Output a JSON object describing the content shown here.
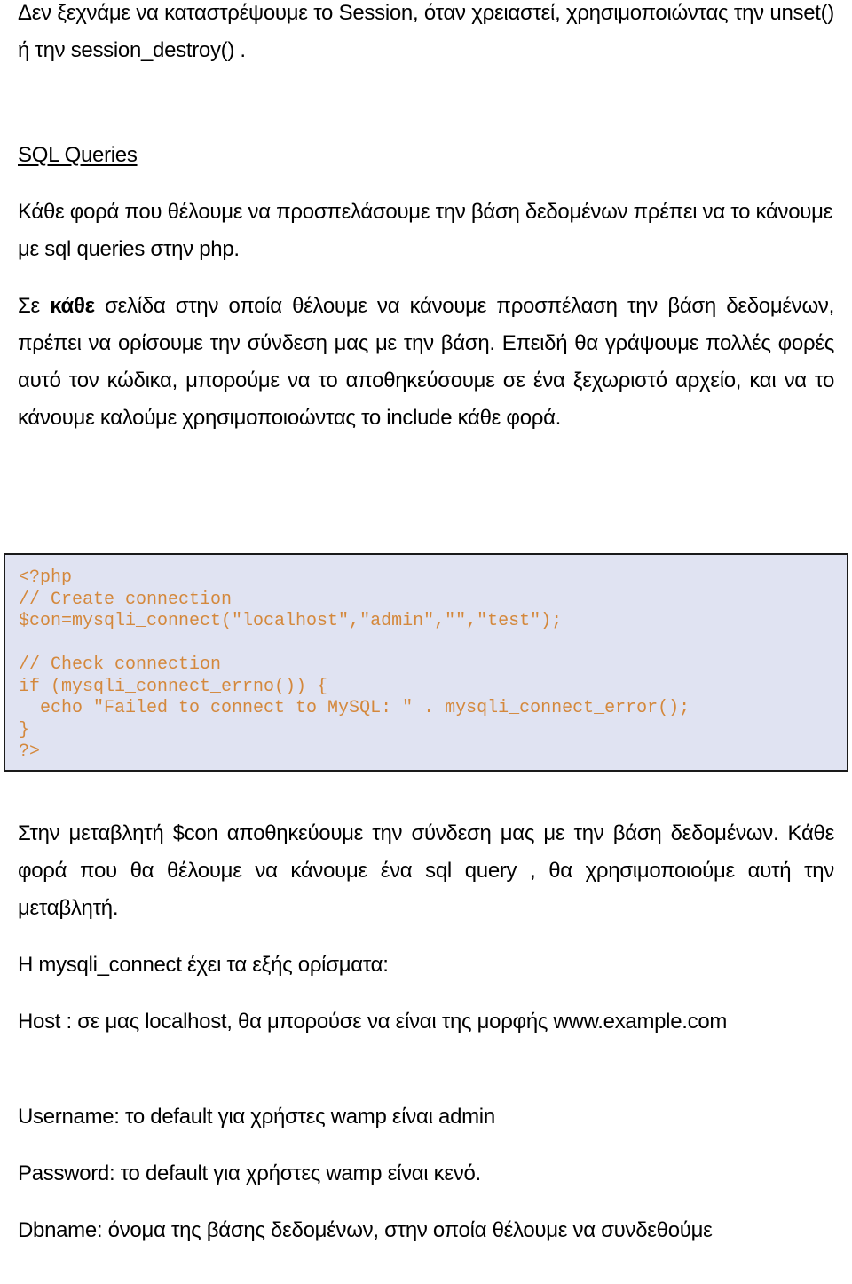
{
  "document": {
    "intro_paragraph": "Δεν ξεχνάμε να καταστρέψουμε το Session, όταν χρειαστεί, χρησιμοποιώντας την unset() ή την session_destroy() .",
    "section_heading": "SQL Queries",
    "paragraph_1": "Κάθε φορά που θέλουμε να προσπελάσουμε την βάση δεδομένων πρέπει να το κάνουμε με sql queries στην php.",
    "paragraph_2": {
      "prefix": "Σε ",
      "bold": "κάθε",
      "suffix": " σελίδα στην οποία θέλουμε να κάνουμε προσπέλαση την βάση δεδομένων, πρέπει να ορίσουμε την σύνδεση μας με την βάση. Επειδή θα γράψουμε πολλές φορές αυτό τον κώδικα, μπορούμε να το αποθηκεύσουμε σε ένα ξεχωριστό αρχείο, και να το κάνουμε καλούμε χρησιμοποιοώντας το include κάθε φορά."
    },
    "code_block": {
      "lines": [
        "<?php",
        "// Create connection",
        "$con=mysqli_connect(\"localhost\",\"admin\",\"\",\"test\");",
        "",
        "// Check connection",
        "if (mysqli_connect_errno()) {",
        "  echo \"Failed to connect to MySQL: \" . mysqli_connect_error();",
        "}",
        "?>"
      ],
      "background_color": "#e0e3f2",
      "text_color": "#d4883c"
    },
    "paragraph_3": "Στην μεταβλητή $con αποθηκεύουμε την σύνδεση μας με την βάση δεδομένων. Κάθε φορά που θα θέλουμε να κάνουμε ένα sql query , θα χρησιμοποιούμε αυτή την μεταβλητή.",
    "paragraph_4": "Η mysqli_connect έχει τα εξής ορίσματα:",
    "arguments": [
      "Host : σε μας localhost, θα μπορούσε να είναι της μορφής www.example.com",
      "Username: το default για χρήστες wamp είναι admin",
      "Password: το default για χρήστες wamp είναι κενό.",
      "Dbname: όνομα της βάσης δεδομένων, στην οποία θέλουμε να συνδεθούμε"
    ]
  }
}
